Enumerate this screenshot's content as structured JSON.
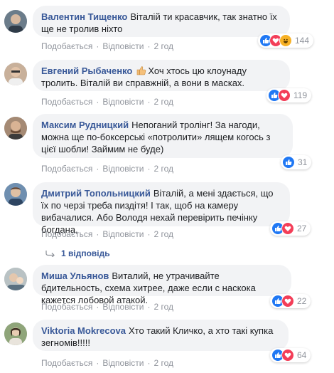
{
  "comments": [
    {
      "name": "Валентин Тищенко",
      "text": "Віталій ти красавчик, так знатно їх ще не тролив ніхто",
      "like": "Подобається",
      "reply": "Відповісти",
      "time": "2 год",
      "reactions": [
        "like",
        "love",
        "haha"
      ],
      "count": "144",
      "avatar_color": "#5a6d7e"
    },
    {
      "name": "Евгений Рыбаченко",
      "text": "Хоч хтось цю клоунаду тролить. Віталій ви справжній, а вони в масках.",
      "like": "Подобається",
      "reply": "Відповісти",
      "time": "2 год",
      "reactions": [
        "like",
        "love"
      ],
      "count": "119",
      "avatar_color": "#b79a82"
    },
    {
      "name": "Максим Рудницкий",
      "text": "Непоганий тролінг! За нагоди, можна ще по-боксерські «потролити» лящем когось з цієї шобли! Займим не буде)",
      "like": "Подобається",
      "reply": "Відповісти",
      "time": "2 год",
      "reactions": [
        "like"
      ],
      "count": "31",
      "avatar_color": "#8d6f5a"
    },
    {
      "name": "Дмитрий Топольницкий",
      "text": "Віталій, а мені здається, що їх по черзі треба пиздітя! І так, щоб на камеру вибачалися. Або Володя нехай перевірить печінку богдана,",
      "like": "Подобається",
      "reply": "Відповісти",
      "time": "2 год",
      "reactions": [
        "like",
        "love"
      ],
      "count": "27",
      "avatar_color": "#4e6a8a"
    },
    {
      "name": "Миша Ульянов",
      "text": "Виталий, не утрачивайте бдительность, схема хитрее, даже если с наскока кажется лобовой атакой.",
      "like": "Подобається",
      "reply": "Відповісти",
      "time": "2 год",
      "reactions": [
        "like",
        "love"
      ],
      "count": "22",
      "avatar_color": "#9aa3a6"
    },
    {
      "name": "Viktoria Mokrecova",
      "text": "Хто такий Кличко, а хто такі купка зегномів!!!!!",
      "like": "Подобається",
      "reply": "Відповісти",
      "time": "2 год",
      "reactions": [
        "like",
        "love"
      ],
      "count": "64",
      "avatar_color": "#7d8d6b"
    }
  ],
  "replies_link": "1 відповідь",
  "colors": {
    "like": "#2078f4",
    "love": "#f33e58",
    "haha": "#f7b125",
    "link": "#385898",
    "meta": "#90949c",
    "bubble": "#f2f3f5"
  }
}
